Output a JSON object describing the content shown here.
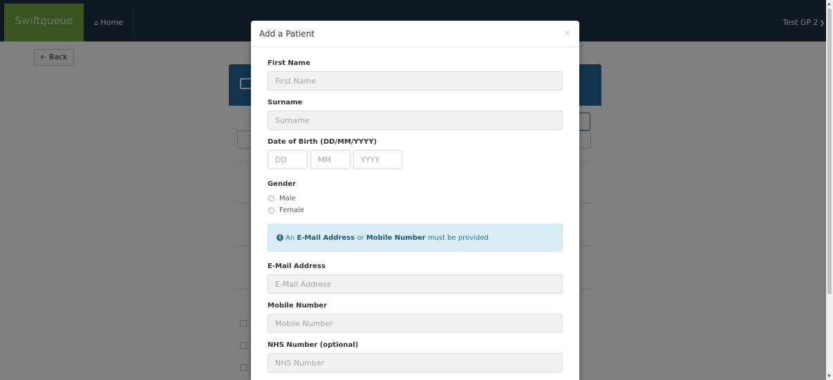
{
  "navbar": {
    "brand": "Swiftqueue",
    "home_label": "Home",
    "user_label": "Test GP 2"
  },
  "page": {
    "back_label": "Back"
  },
  "modal": {
    "title": "Add a Patient",
    "close_glyph": "×",
    "fields": {
      "first_name": {
        "label": "First Name",
        "placeholder": "First Name"
      },
      "surname": {
        "label": "Surname",
        "placeholder": "Surname"
      },
      "dob": {
        "label": "Date of Birth (DD/MM/YYYY)",
        "dd_placeholder": "DD",
        "mm_placeholder": "MM",
        "yyyy_placeholder": "YYYY"
      },
      "gender": {
        "label": "Gender",
        "options": [
          "Male",
          "Female"
        ]
      },
      "email": {
        "label": "E-Mail Address",
        "placeholder": "E-Mail Address"
      },
      "mobile": {
        "label": "Mobile Number",
        "placeholder": "Mobile Number"
      },
      "nhs": {
        "label": "NHS Number (optional)",
        "placeholder": "NHS Number"
      }
    },
    "alert": {
      "prefix": "An ",
      "email": "E-Mail Address",
      "middle": " or ",
      "mobile": "Mobile Number",
      "suffix": " must be provided"
    }
  },
  "colors": {
    "navbar": "#1f3344",
    "brand": "#75a843",
    "alert_bg": "#d9edf7",
    "card_header": "#24689a"
  },
  "icons": {
    "home": "home-icon",
    "back": "arrow-left-icon",
    "user_menu": "chevron-down-icon",
    "info": "info-circle-icon",
    "calendar": "calendar-icon"
  }
}
